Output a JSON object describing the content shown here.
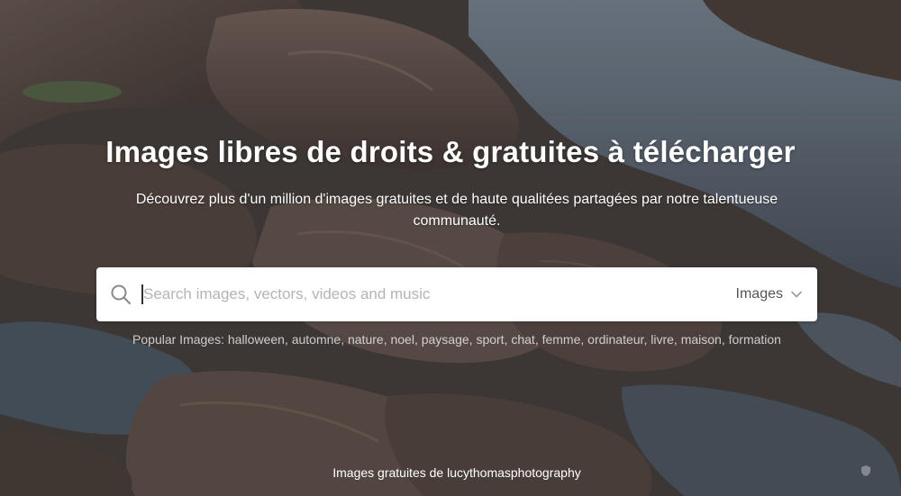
{
  "hero": {
    "title": "Images libres de droits & gratuites à télécharger",
    "subtitle": "Découvrez plus d'un million d'images gratuites et de haute qualitées partagées par notre talentueuse communauté."
  },
  "search": {
    "icon": "search-icon",
    "placeholder": "Search images, vectors, videos and music",
    "value": "",
    "type_selected": "Images",
    "type_icon": "chevron-down-icon"
  },
  "popular": {
    "label": "Popular Images:",
    "tags": [
      "halloween",
      "automne",
      "nature",
      "noel",
      "paysage",
      "sport",
      "chat",
      "femme",
      "ordinateur",
      "livre",
      "maison",
      "formation"
    ]
  },
  "credit": {
    "prefix": "Images gratuites de",
    "author": "lucythomasphotography"
  },
  "colors": {
    "title_text": "#ffffff",
    "search_bg": "#ffffff",
    "placeholder": "#b4b4b4",
    "popular_text": "#e6e6e6"
  }
}
